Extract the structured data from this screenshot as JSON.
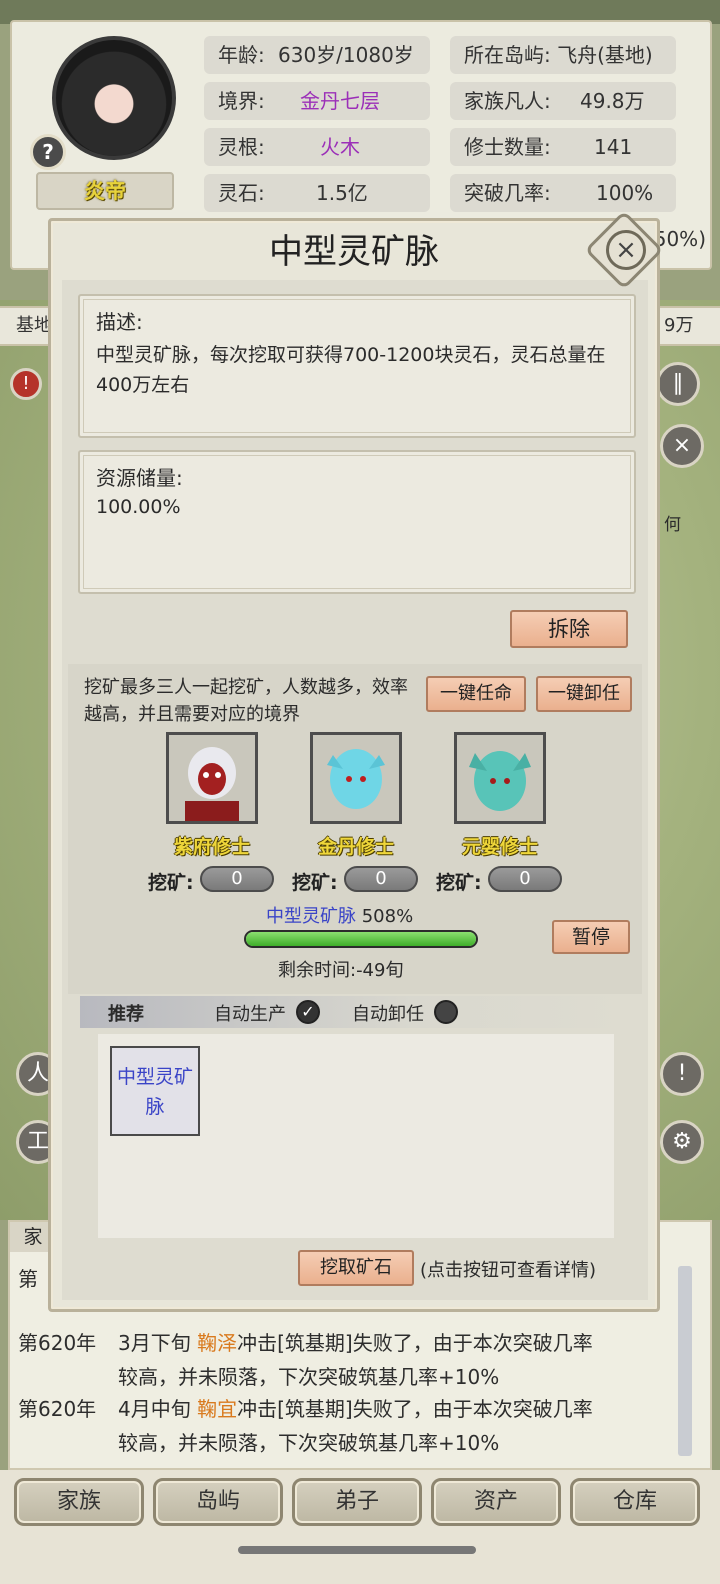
{
  "profile": {
    "name": "炎帝",
    "help": "?",
    "age_label": "年龄:",
    "age_value": "630岁/1080岁",
    "realm_label": "境界:",
    "realm_value": "金丹七层",
    "root_label": "灵根:",
    "root_value": "火木",
    "stone_label": "灵石:",
    "stone_value": "1.5亿",
    "island_label": "所在岛屿:",
    "island_value": "飞舟(基地)",
    "mortals_label": "家族凡人:",
    "mortals_value": "49.8万",
    "cultivators_label": "修士数量:",
    "cultivators_value": "141",
    "breakthrough_label": "突破几率:",
    "breakthrough_value": "100%",
    "partial_stat": "50%)"
  },
  "background": {
    "strip_left": "基地",
    "strip_right": "9万",
    "side_text": "何"
  },
  "dialog": {
    "title": "中型灵矿脉",
    "close": "×",
    "desc_label": "描述:",
    "desc_text": "中型灵矿脉，每次挖取可获得700-1200块灵石，灵石总量在400万左右",
    "resource_label": "资源储量:",
    "resource_value": "100.00%",
    "demolish": "拆除",
    "mining_hint": "挖矿最多三人一起挖矿，人数越多，效率越高，并且需要对应的境界",
    "appoint_all": "一键任命",
    "dismiss_all": "一键卸任",
    "slots": [
      {
        "title": "紫府修士",
        "mine_label": "挖矿:",
        "count": "0"
      },
      {
        "title": "金丹修士",
        "mine_label": "挖矿:",
        "count": "0"
      },
      {
        "title": "元婴修士",
        "mine_label": "挖矿:",
        "count": "0"
      }
    ],
    "progress_name": "中型灵矿脉",
    "progress_percent": "508%",
    "progress_fill": 1.0,
    "pause": "暂停",
    "remaining": "剩余时间:-49旬",
    "recommend": "推荐",
    "auto_produce": "自动生产",
    "auto_produce_mark": "✓",
    "auto_dismiss": "自动卸任",
    "product_card": "中型灵矿脉",
    "mine_ore": "挖取矿石",
    "mine_ore_hint": "(点击按钮可查看详情)"
  },
  "log": {
    "tab": "家",
    "rows": [
      {
        "year": "第",
        "text": ""
      },
      {
        "year": "第620年",
        "prefix": "3月下旬 ",
        "name": "鞠泽",
        "text": "冲击[筑基期]失败了，由于本次突破几率"
      },
      {
        "year": "",
        "prefix": "",
        "name": "",
        "text": "较高，并未陨落，下次突破筑基几率+10%"
      },
      {
        "year": "第620年",
        "prefix": "4月中旬 ",
        "name": "鞠宜",
        "text": "冲击[筑基期]失败了，由于本次突破几率"
      },
      {
        "year": "",
        "prefix": "",
        "name": "",
        "text": "较高，并未陨落，下次突破筑基几率+10%"
      }
    ]
  },
  "nav": [
    "家族",
    "岛屿",
    "弟子",
    "资产",
    "仓库"
  ]
}
